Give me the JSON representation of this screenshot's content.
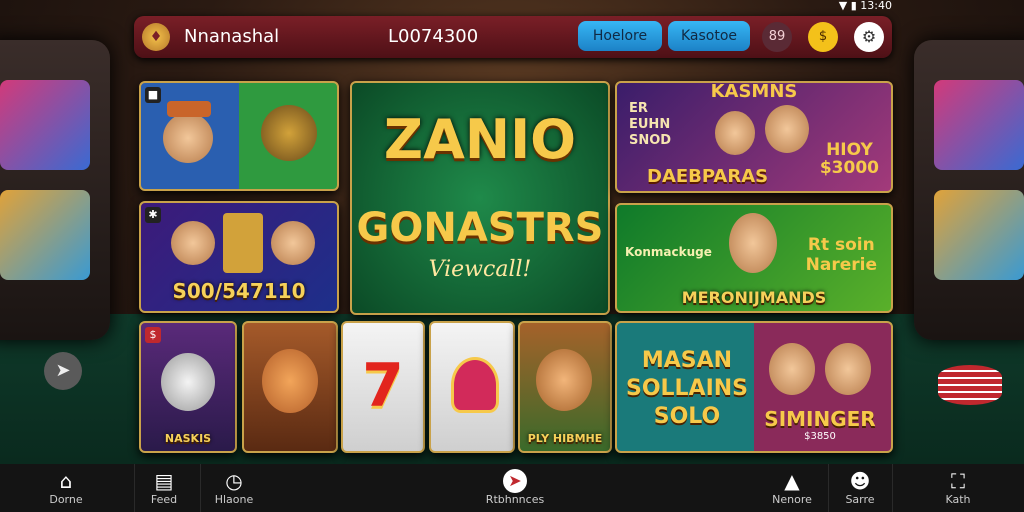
{
  "status": {
    "time": "13:40"
  },
  "header": {
    "app_name": "Nnanashal",
    "balance": "L0074300",
    "btn1": "Hoelore",
    "btn2": "Kasotoe",
    "badge1": "89",
    "badge2": "$"
  },
  "tiles": {
    "jackpot": "S00/547110",
    "featured_title": "ZANIO",
    "featured_sub": "GONASTRS",
    "featured_sub2": "Viewcall!",
    "promo1_top": "KASMNS",
    "promo1_left": "ER\nEUHN\nSNOD",
    "promo1_right": "HIOY\n$3000",
    "promo1_bottom": "DAEBPARAS",
    "promo2_left": "Konmackuge",
    "promo2_right": "Rt soin\nNarerie",
    "promo2_bottom": "MERONIJMANDS",
    "game1_cap": "NASKIS",
    "game5_cap": "PLY HIBMHE",
    "seven": "7",
    "promo3_left": "MASAN\nSOLLAINS\nSOLO",
    "promo3_right": "SIMINGER",
    "promo3_small": "$3850"
  },
  "nav": {
    "home": "Dorne",
    "feed": "Feed",
    "second": "Hlaone",
    "center": "Rtbhnnces",
    "rewards": "Nenore",
    "profile": "Sarre",
    "last": "Kath"
  }
}
